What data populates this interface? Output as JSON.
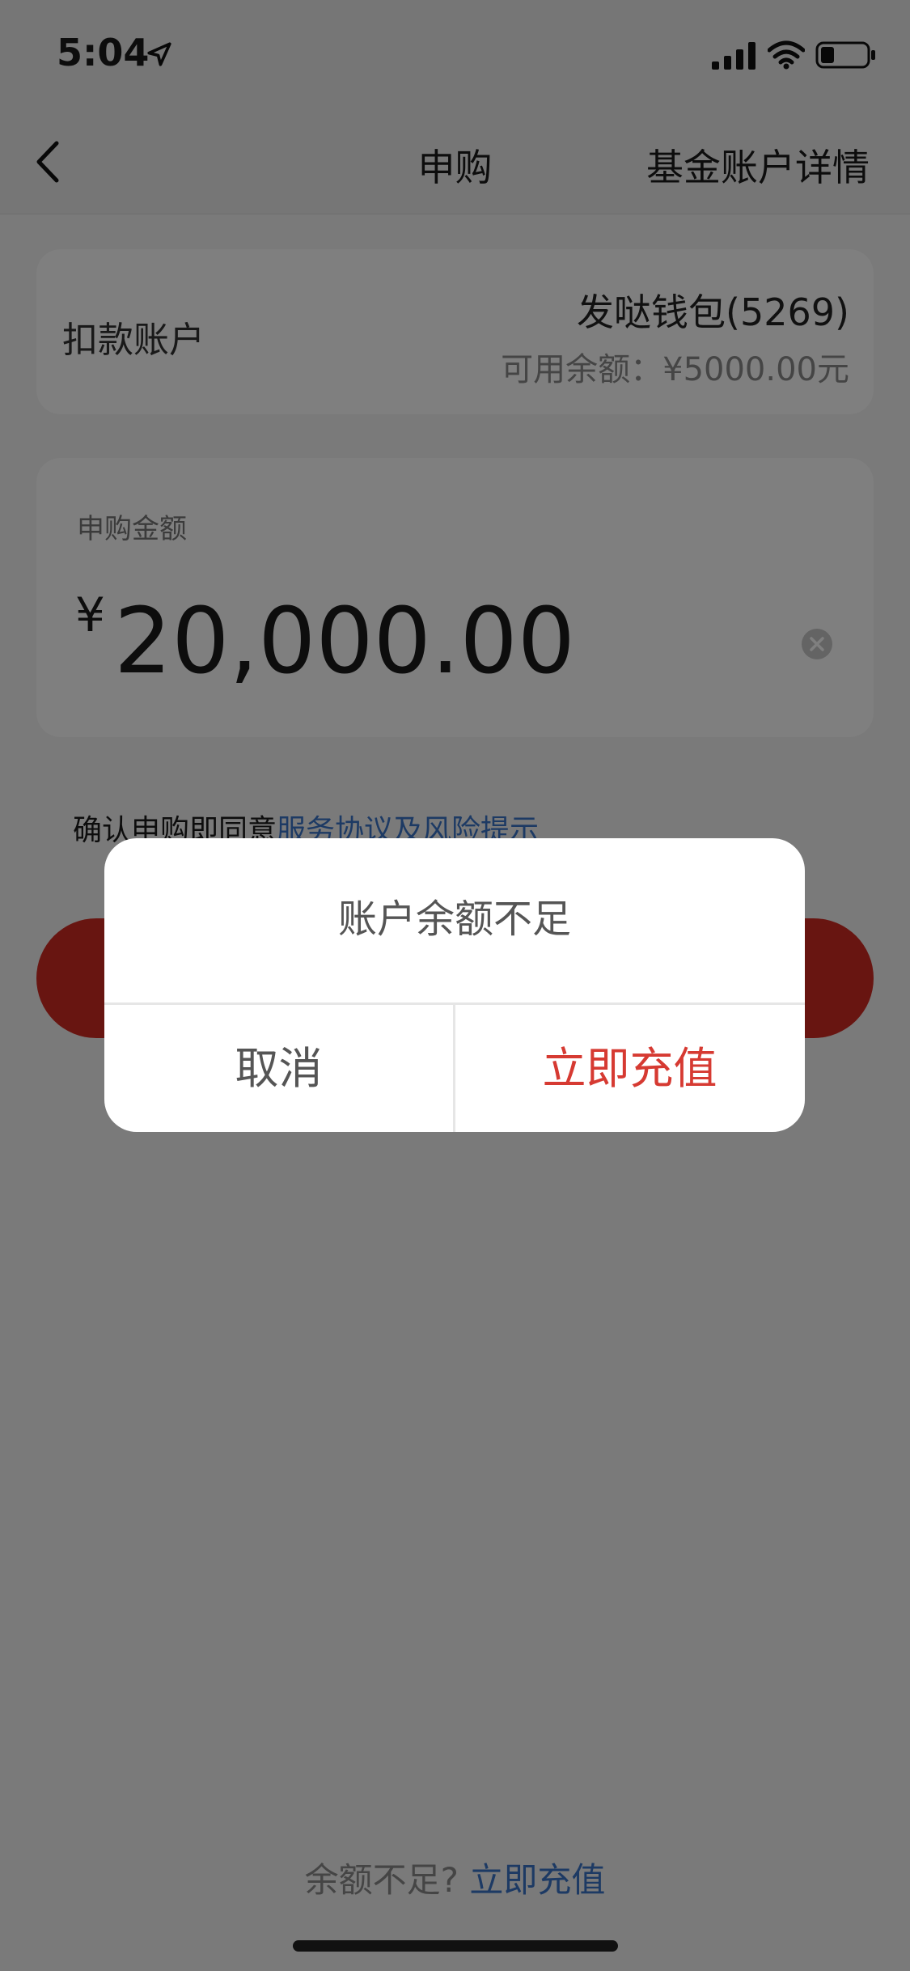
{
  "status_bar": {
    "time": "5:04",
    "icons": [
      "location-arrow-icon",
      "signal-icon",
      "wifi-icon",
      "battery-icon"
    ]
  },
  "nav": {
    "title": "申购",
    "right_action": "基金账户详情",
    "back_icon": "chevron-left-icon"
  },
  "account": {
    "label": "扣款账户",
    "name": "发哒钱包(5269)",
    "balance": "可用余额：¥5000.00元"
  },
  "amount": {
    "label": "申购金额",
    "currency": "¥",
    "value": "20,000.00",
    "clear_icon": "clear-circle-icon"
  },
  "agreement": {
    "prefix": "确认申购即同意",
    "link": "服务协议及风险提示"
  },
  "bottom_hint": {
    "prefix": "余额不足?",
    "link": "立即充值"
  },
  "dialog": {
    "message": "账户余额不足",
    "cancel": "取消",
    "confirm": "立即充值"
  },
  "colors": {
    "accent_red": "#d63a32",
    "button_red": "#d02a22",
    "link_blue": "#3a74c8",
    "overlay": "rgba(0,0,0,0.5)"
  }
}
